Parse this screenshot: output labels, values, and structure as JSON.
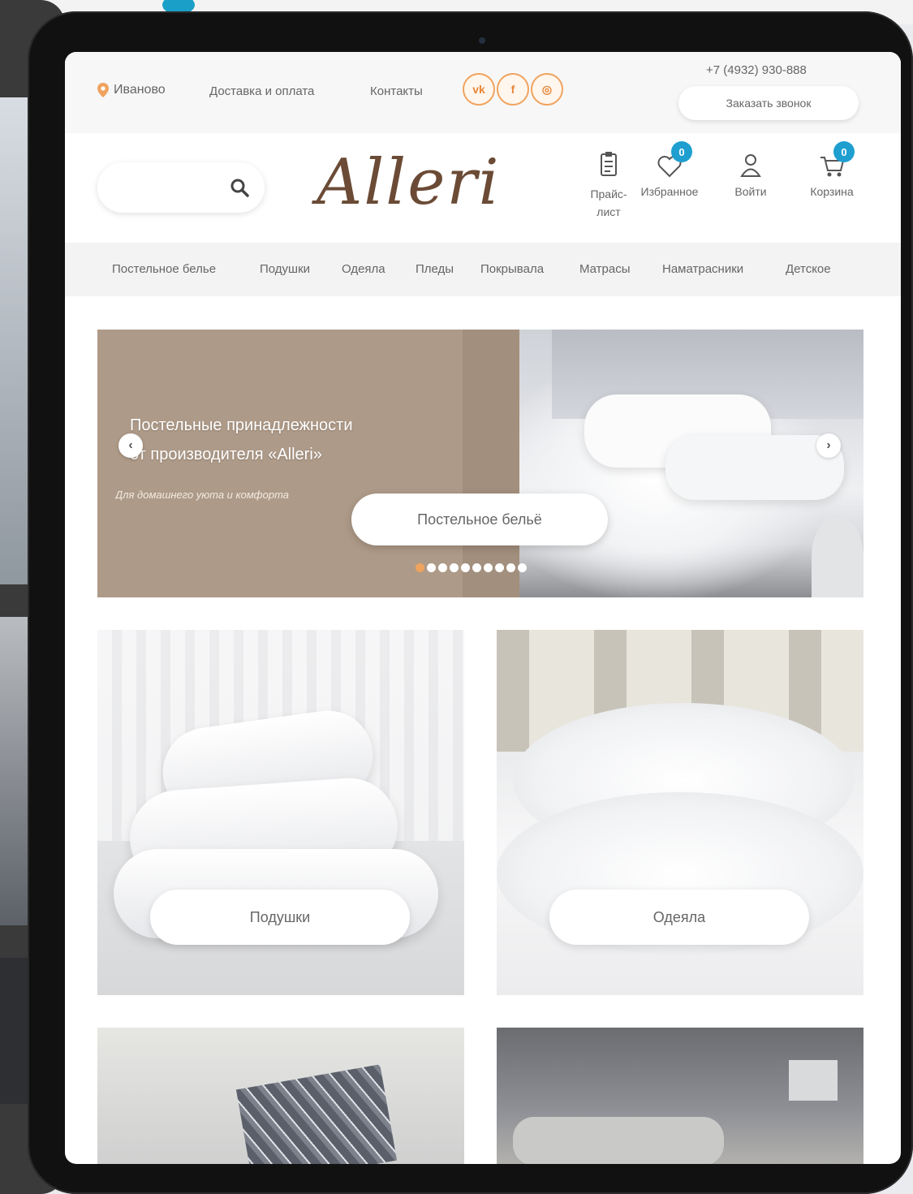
{
  "topbar": {
    "city": "Иваново",
    "links": [
      "Доставка и оплата",
      "Контакты"
    ],
    "socials": [
      "vk-icon",
      "facebook-icon",
      "instagram-icon"
    ],
    "phone": "+7 (4932) 930-888",
    "callback_label": "Заказать звонок"
  },
  "header": {
    "logo": "Alleri",
    "search_placeholder": "",
    "icons": [
      {
        "icon": "price-list-icon",
        "label": "Прайс-лист",
        "badge": ""
      },
      {
        "icon": "heart-icon",
        "label": "Избранное",
        "badge": "0"
      },
      {
        "icon": "user-icon",
        "label": "Войти",
        "badge": ""
      },
      {
        "icon": "cart-icon",
        "label": "Корзина",
        "badge": "0"
      }
    ]
  },
  "nav": {
    "items": [
      "Постельное белье",
      "Подушки",
      "Одеяла",
      "Пледы",
      "Покрывала",
      "Матрасы",
      "Наматрасники",
      "Детское"
    ]
  },
  "slider": {
    "title_line1": "Постельные принадлежности",
    "title_line2": "от производителя «Alleri»",
    "subtitle": "Для домашнего уюта и комфорта",
    "button_label": "Постельное бельё",
    "dots_count": 10,
    "active_dot": 0
  },
  "categories": [
    {
      "label": "Подушки"
    },
    {
      "label": "Одеяла"
    }
  ],
  "colors": {
    "accent": "#f0a35e",
    "badge": "#1e9fd0",
    "slide_bg": "#ae9a88",
    "logo": "#6b4b36"
  }
}
